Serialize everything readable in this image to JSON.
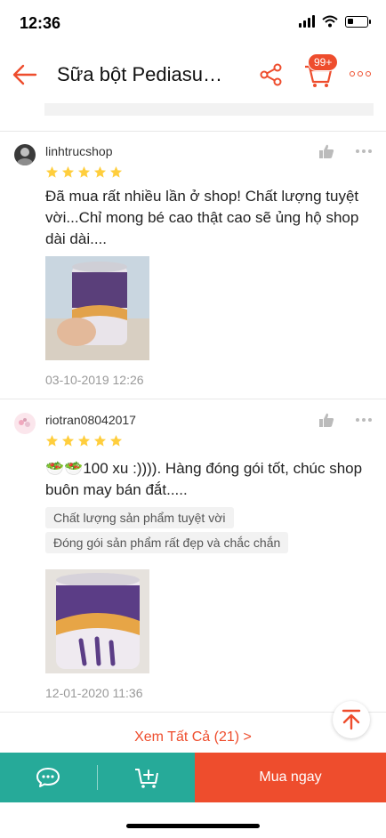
{
  "status_bar": {
    "time": "12:36"
  },
  "header": {
    "title": "Sữa bột Pediasu…",
    "cart_badge": "99+"
  },
  "reviews": [
    {
      "username": "linhtrucshop",
      "rating": 5,
      "text": "Đã mua rất nhiều lần ở shop! Chất lượng tuyệt vời...Chỉ mong bé cao thật cao sẽ ủng hộ shop dài dài....",
      "tags": [],
      "date": "03-10-2019 12:26"
    },
    {
      "username": "riotran08042017",
      "rating": 5,
      "text": "🥗🥗100 xu :)))). Hàng đóng gói tốt, chúc shop buôn may bán đắt.....",
      "tags": [
        "Chất lượng sản phẩm tuyệt vời",
        "Đóng gói sản phẩm rất đẹp và chắc chắn"
      ],
      "date": "12-01-2020 11:36"
    }
  ],
  "see_all": "Xem Tất Cả (21) >",
  "bottom_bar": {
    "buy_label": "Mua ngay"
  },
  "colors": {
    "accent": "#ee4d2d",
    "teal": "#26aa99",
    "star": "#ffce3d"
  }
}
